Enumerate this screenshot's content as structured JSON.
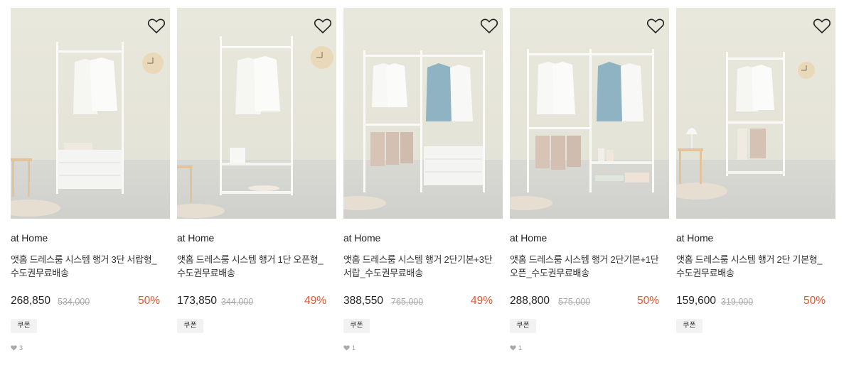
{
  "colors": {
    "discount": "#e9542e",
    "coupon_bg": "#f2f2f2",
    "muted": "#aaaaaa"
  },
  "products": [
    {
      "brand": "at Home",
      "title": "앳홈 드레스룸 시스템 행거 3단 서랍형_수도권무료배송",
      "price": "268,850",
      "original_price": "534,000",
      "discount": "50%",
      "coupon": "쿠폰",
      "likes": "3",
      "variant": "drawer-3"
    },
    {
      "brand": "at Home",
      "title": "앳홈 드레스룸 시스템 행거 1단 오픈형_수도권무료배송",
      "price": "173,850",
      "original_price": "344,000",
      "discount": "49%",
      "coupon": "쿠폰",
      "likes": "",
      "variant": "open-1"
    },
    {
      "brand": "at Home",
      "title": "앳홈 드레스룸 시스템 행거 2단기본+3단서랍_수도권무료배송",
      "price": "388,550",
      "original_price": "765,000",
      "discount": "49%",
      "coupon": "쿠폰",
      "likes": "1",
      "variant": "double-drawer"
    },
    {
      "brand": "at Home",
      "title": "앳홈 드레스룸 시스템 행거 2단기본+1단오픈_수도권무료배송",
      "price": "288,800",
      "original_price": "575,000",
      "discount": "50%",
      "coupon": "쿠폰",
      "likes": "1",
      "variant": "double-open"
    },
    {
      "brand": "at Home",
      "title": "앳홈 드레스룸 시스템 행거 2단 기본형_수도권무료배송",
      "price": "159,600",
      "original_price": "319,000",
      "discount": "50%",
      "coupon": "쿠폰",
      "likes": "",
      "variant": "basic-2"
    }
  ]
}
